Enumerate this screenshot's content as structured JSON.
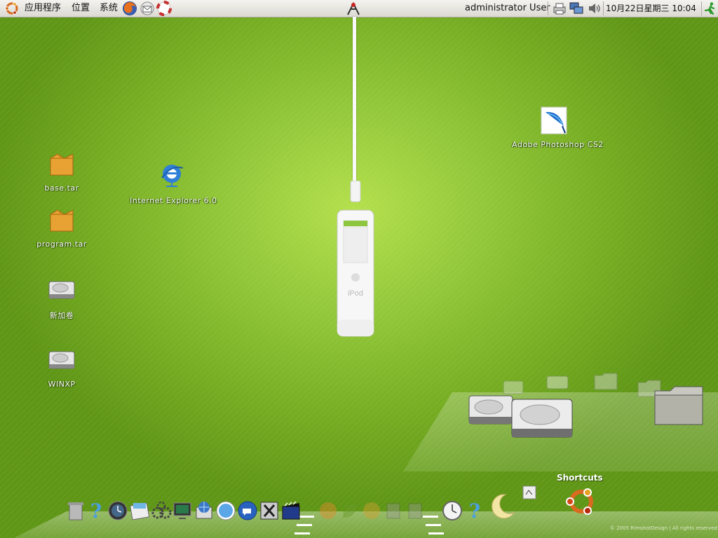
{
  "top_panel": {
    "menus": [
      "应用程序",
      "位置",
      "系统"
    ],
    "launchers": [
      "firefox-icon",
      "mail-icon",
      "help-icon"
    ],
    "center_icon": "figure-icon",
    "user_label": "administrator User",
    "tray": [
      "printer-icon",
      "network-icon",
      "volume-icon"
    ],
    "clock": "10月22日星期三 10:04",
    "logout": "running-man-icon"
  },
  "desktop": {
    "icons": [
      {
        "label": "base.tar",
        "icon": "package-icon"
      },
      {
        "label": "program.tar",
        "icon": "package-icon"
      },
      {
        "label": "新加卷",
        "icon": "hard-drive-icon"
      },
      {
        "label": "WINXP",
        "icon": "hard-drive-icon"
      },
      {
        "label": "Internet Explorer 6.0",
        "icon": "ie-icon"
      },
      {
        "label": "Adobe Photoshop CS2",
        "icon": "photoshop-icon"
      }
    ]
  },
  "ipod": {
    "brand": "iPod"
  },
  "shortcuts": {
    "title": "Shortcuts"
  },
  "dock": {
    "left_icons": [
      "trash-icon",
      "help-question-icon",
      "clock-icon",
      "notebook-icon",
      "settings-gears-icon",
      "monitor-icon",
      "globe-icon",
      "safari-icon",
      "chat-icon",
      "x11-icon",
      "movie-icon"
    ],
    "faded_icons": [
      "faded-firefox-icon",
      "faded-leaf-icon",
      "faded-globe-icon",
      "faded-box-icon",
      "faded-box2-icon"
    ],
    "right_icons": [
      "time-icon",
      "help2-icon",
      "moon-icon",
      "ubuntu-icon"
    ],
    "copyright": "© 2005 RimshotDesign | All rights reserved"
  },
  "colors": {
    "panel": "#e8e6e0",
    "desktop_green": "#8bc034"
  }
}
